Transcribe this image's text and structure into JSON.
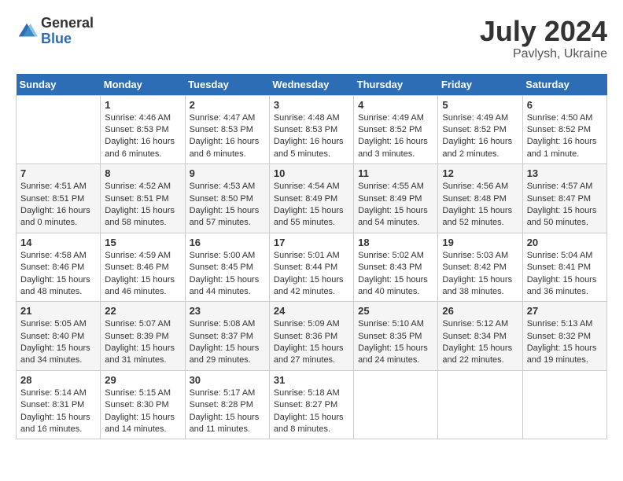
{
  "logo": {
    "general": "General",
    "blue": "Blue"
  },
  "title": {
    "month_year": "July 2024",
    "location": "Pavlysh, Ukraine"
  },
  "days_of_week": [
    "Sunday",
    "Monday",
    "Tuesday",
    "Wednesday",
    "Thursday",
    "Friday",
    "Saturday"
  ],
  "weeks": [
    [
      {
        "day": "",
        "info": ""
      },
      {
        "day": "1",
        "info": "Sunrise: 4:46 AM\nSunset: 8:53 PM\nDaylight: 16 hours\nand 6 minutes."
      },
      {
        "day": "2",
        "info": "Sunrise: 4:47 AM\nSunset: 8:53 PM\nDaylight: 16 hours\nand 6 minutes."
      },
      {
        "day": "3",
        "info": "Sunrise: 4:48 AM\nSunset: 8:53 PM\nDaylight: 16 hours\nand 5 minutes."
      },
      {
        "day": "4",
        "info": "Sunrise: 4:49 AM\nSunset: 8:52 PM\nDaylight: 16 hours\nand 3 minutes."
      },
      {
        "day": "5",
        "info": "Sunrise: 4:49 AM\nSunset: 8:52 PM\nDaylight: 16 hours\nand 2 minutes."
      },
      {
        "day": "6",
        "info": "Sunrise: 4:50 AM\nSunset: 8:52 PM\nDaylight: 16 hours\nand 1 minute."
      }
    ],
    [
      {
        "day": "7",
        "info": "Sunrise: 4:51 AM\nSunset: 8:51 PM\nDaylight: 16 hours\nand 0 minutes."
      },
      {
        "day": "8",
        "info": "Sunrise: 4:52 AM\nSunset: 8:51 PM\nDaylight: 15 hours\nand 58 minutes."
      },
      {
        "day": "9",
        "info": "Sunrise: 4:53 AM\nSunset: 8:50 PM\nDaylight: 15 hours\nand 57 minutes."
      },
      {
        "day": "10",
        "info": "Sunrise: 4:54 AM\nSunset: 8:49 PM\nDaylight: 15 hours\nand 55 minutes."
      },
      {
        "day": "11",
        "info": "Sunrise: 4:55 AM\nSunset: 8:49 PM\nDaylight: 15 hours\nand 54 minutes."
      },
      {
        "day": "12",
        "info": "Sunrise: 4:56 AM\nSunset: 8:48 PM\nDaylight: 15 hours\nand 52 minutes."
      },
      {
        "day": "13",
        "info": "Sunrise: 4:57 AM\nSunset: 8:47 PM\nDaylight: 15 hours\nand 50 minutes."
      }
    ],
    [
      {
        "day": "14",
        "info": "Sunrise: 4:58 AM\nSunset: 8:46 PM\nDaylight: 15 hours\nand 48 minutes."
      },
      {
        "day": "15",
        "info": "Sunrise: 4:59 AM\nSunset: 8:46 PM\nDaylight: 15 hours\nand 46 minutes."
      },
      {
        "day": "16",
        "info": "Sunrise: 5:00 AM\nSunset: 8:45 PM\nDaylight: 15 hours\nand 44 minutes."
      },
      {
        "day": "17",
        "info": "Sunrise: 5:01 AM\nSunset: 8:44 PM\nDaylight: 15 hours\nand 42 minutes."
      },
      {
        "day": "18",
        "info": "Sunrise: 5:02 AM\nSunset: 8:43 PM\nDaylight: 15 hours\nand 40 minutes."
      },
      {
        "day": "19",
        "info": "Sunrise: 5:03 AM\nSunset: 8:42 PM\nDaylight: 15 hours\nand 38 minutes."
      },
      {
        "day": "20",
        "info": "Sunrise: 5:04 AM\nSunset: 8:41 PM\nDaylight: 15 hours\nand 36 minutes."
      }
    ],
    [
      {
        "day": "21",
        "info": "Sunrise: 5:05 AM\nSunset: 8:40 PM\nDaylight: 15 hours\nand 34 minutes."
      },
      {
        "day": "22",
        "info": "Sunrise: 5:07 AM\nSunset: 8:39 PM\nDaylight: 15 hours\nand 31 minutes."
      },
      {
        "day": "23",
        "info": "Sunrise: 5:08 AM\nSunset: 8:37 PM\nDaylight: 15 hours\nand 29 minutes."
      },
      {
        "day": "24",
        "info": "Sunrise: 5:09 AM\nSunset: 8:36 PM\nDaylight: 15 hours\nand 27 minutes."
      },
      {
        "day": "25",
        "info": "Sunrise: 5:10 AM\nSunset: 8:35 PM\nDaylight: 15 hours\nand 24 minutes."
      },
      {
        "day": "26",
        "info": "Sunrise: 5:12 AM\nSunset: 8:34 PM\nDaylight: 15 hours\nand 22 minutes."
      },
      {
        "day": "27",
        "info": "Sunrise: 5:13 AM\nSunset: 8:32 PM\nDaylight: 15 hours\nand 19 minutes."
      }
    ],
    [
      {
        "day": "28",
        "info": "Sunrise: 5:14 AM\nSunset: 8:31 PM\nDaylight: 15 hours\nand 16 minutes."
      },
      {
        "day": "29",
        "info": "Sunrise: 5:15 AM\nSunset: 8:30 PM\nDaylight: 15 hours\nand 14 minutes."
      },
      {
        "day": "30",
        "info": "Sunrise: 5:17 AM\nSunset: 8:28 PM\nDaylight: 15 hours\nand 11 minutes."
      },
      {
        "day": "31",
        "info": "Sunrise: 5:18 AM\nSunset: 8:27 PM\nDaylight: 15 hours\nand 8 minutes."
      },
      {
        "day": "",
        "info": ""
      },
      {
        "day": "",
        "info": ""
      },
      {
        "day": "",
        "info": ""
      }
    ]
  ]
}
